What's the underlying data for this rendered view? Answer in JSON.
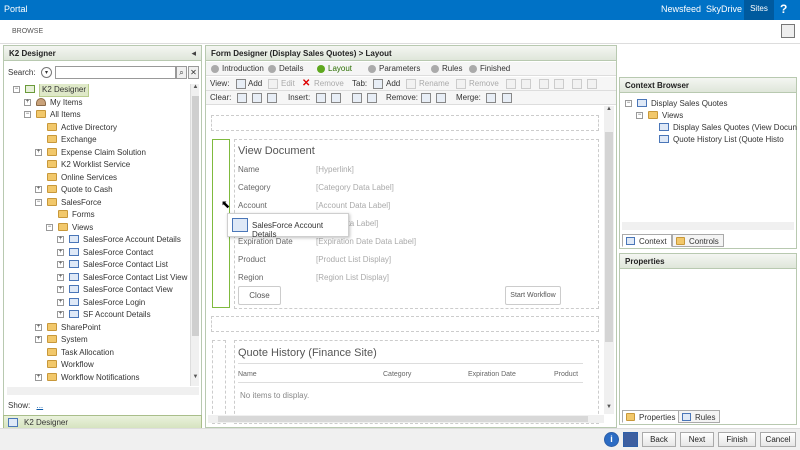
{
  "topbar": {
    "portal": "Portal",
    "newsfeed": "Newsfeed",
    "skydrive": "SkyDrive",
    "sites": "Sites",
    "help": "?"
  },
  "ribbon": {
    "browse": "BROWSE"
  },
  "left_panel": {
    "title": "K2 Designer",
    "search_label": "Search:",
    "search_value": "",
    "tree": [
      {
        "label": "K2 Designer",
        "level": 0,
        "exp": "−",
        "icon": "k2",
        "sel": true
      },
      {
        "label": "My Items",
        "level": 1,
        "exp": "+",
        "icon": "user"
      },
      {
        "label": "All Items",
        "level": 1,
        "exp": "−",
        "icon": "folder"
      },
      {
        "label": "Active Directory",
        "level": 2,
        "exp": "",
        "icon": "folder"
      },
      {
        "label": "Exchange",
        "level": 2,
        "exp": "",
        "icon": "folder"
      },
      {
        "label": "Expense Claim Solution",
        "level": 2,
        "exp": "+",
        "icon": "folder"
      },
      {
        "label": "K2 Worklist Service",
        "level": 2,
        "exp": "",
        "icon": "folder"
      },
      {
        "label": "Online Services",
        "level": 2,
        "exp": "",
        "icon": "folder"
      },
      {
        "label": "Quote to Cash",
        "level": 2,
        "exp": "+",
        "icon": "folder"
      },
      {
        "label": "SalesForce",
        "level": 2,
        "exp": "−",
        "icon": "folder"
      },
      {
        "label": "Forms",
        "level": 3,
        "exp": "",
        "icon": "folder"
      },
      {
        "label": "Views",
        "level": 3,
        "exp": "−",
        "icon": "folder"
      },
      {
        "label": "SalesForce Account Details",
        "level": 4,
        "exp": "+",
        "icon": "view"
      },
      {
        "label": "SalesForce Contact",
        "level": 4,
        "exp": "+",
        "icon": "view"
      },
      {
        "label": "SalesForce Contact List",
        "level": 4,
        "exp": "+",
        "icon": "view"
      },
      {
        "label": "SalesForce Contact List View",
        "level": 4,
        "exp": "+",
        "icon": "view"
      },
      {
        "label": "SalesForce Contact View",
        "level": 4,
        "exp": "+",
        "icon": "view"
      },
      {
        "label": "SalesForce Login",
        "level": 4,
        "exp": "+",
        "icon": "view"
      },
      {
        "label": "SF Account Details",
        "level": 4,
        "exp": "+",
        "icon": "view"
      },
      {
        "label": "SharePoint",
        "level": 2,
        "exp": "+",
        "icon": "folder"
      },
      {
        "label": "System",
        "level": 2,
        "exp": "+",
        "icon": "folder"
      },
      {
        "label": "Task Allocation",
        "level": 2,
        "exp": "",
        "icon": "folder"
      },
      {
        "label": "Workflow",
        "level": 2,
        "exp": "",
        "icon": "folder"
      },
      {
        "label": "Workflow Notifications",
        "level": 2,
        "exp": "+",
        "icon": "folder"
      }
    ],
    "show_label": "Show:",
    "show_value": "...",
    "footer": "K2 Designer"
  },
  "center": {
    "title": "Form Designer (Display Sales Quotes) > Layout",
    "steps": [
      "Introduction",
      "Details",
      "Layout",
      "Parameters",
      "Rules",
      "Finished"
    ],
    "active_step": 2,
    "tb1": {
      "view": "View:",
      "add": "Add",
      "edit": "Edit",
      "remove": "Remove",
      "tab": "Tab:",
      "tab_add": "Add",
      "tab_rename": "Rename",
      "tab_remove": "Remove"
    },
    "tb2": {
      "clear": "Clear:",
      "insert": "Insert:",
      "remove": "Remove:",
      "merge": "Merge:"
    },
    "view_doc": {
      "title": "View Document",
      "fields": [
        {
          "label": "Name",
          "value": "[Hyperlink]"
        },
        {
          "label": "Category",
          "value": "[Category Data Label]"
        },
        {
          "label": "Account",
          "value": "[Account Data Label]"
        },
        {
          "label": "Date",
          "value": "[Date Data Label]"
        },
        {
          "label": "Expiration Date",
          "value": "[Expiration Date Data Label]"
        },
        {
          "label": "Product",
          "value": "[Product List Display]"
        },
        {
          "label": "Region",
          "value": "[Region List Display]"
        }
      ],
      "close": "Close",
      "start": "Start Workflow"
    },
    "drag_label": "SalesForce Account Details",
    "quote": {
      "title": "Quote History (Finance Site)",
      "columns": [
        "Name",
        "Category",
        "Expiration Date",
        "Product"
      ],
      "empty": "No items to display."
    }
  },
  "context": {
    "title": "Context Browser",
    "tree": [
      "Display Sales Quotes",
      "Views",
      "Display Sales Quotes (View Docun",
      "Quote History List (Quote Histo"
    ],
    "tabs": [
      "Context",
      "Controls"
    ]
  },
  "properties": {
    "title": "Properties",
    "tabs": [
      "Properties",
      "Rules"
    ]
  },
  "nav": {
    "back": "Back",
    "next": "Next",
    "finish": "Finish",
    "cancel": "Cancel",
    "info": "i"
  }
}
